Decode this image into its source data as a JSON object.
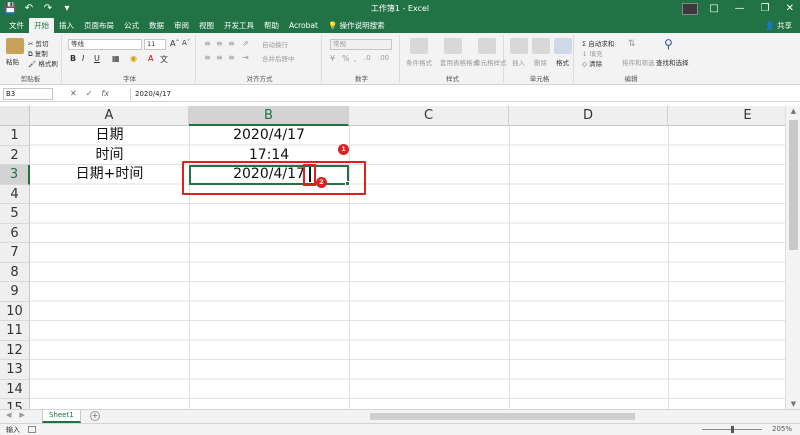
{
  "window": {
    "title": "工作簿1 - Excel"
  },
  "menu_tabs": [
    "文件",
    "开始",
    "插入",
    "页面布局",
    "公式",
    "数据",
    "审阅",
    "视图",
    "开发工具",
    "帮助",
    "Acrobat",
    "操作说明搜索"
  ],
  "share_label": "共享",
  "ribbon": {
    "clipboard": {
      "paste": "粘贴",
      "cut": "剪切",
      "copy": "复制",
      "format_painter": "格式刷",
      "label": "剪贴板"
    },
    "font": {
      "name": "等线",
      "size": "11",
      "label": "字体"
    },
    "alignment": {
      "wrap": "自动换行",
      "merge": "合并后居中",
      "label": "对齐方式"
    },
    "number": {
      "format": "常规",
      "label": "数字"
    },
    "styles": {
      "conditional": "条件格式",
      "table": "套用表格格式",
      "cell_styles": "单元格样式",
      "label": "样式"
    },
    "cells": {
      "insert": "插入",
      "delete": "删除",
      "format": "格式",
      "label": "单元格"
    },
    "editing": {
      "autosum": "自动求和",
      "fill": "填充",
      "clear": "清除",
      "sort": "排序和筛选",
      "find": "查找和选择",
      "label": "编辑"
    }
  },
  "formula_bar": {
    "name_box": "B3",
    "content": "2020/4/17"
  },
  "columns": [
    "A",
    "B",
    "C",
    "D",
    "E"
  ],
  "rows": [
    "1",
    "2",
    "3",
    "4",
    "5",
    "6",
    "7",
    "8",
    "9",
    "10",
    "11",
    "12",
    "13",
    "14",
    "15"
  ],
  "cells": {
    "A1": "日期",
    "B1": "2020/4/17",
    "A2": "时间",
    "B2": "17:14",
    "A3": "日期+时间",
    "B3": "2020/4/17"
  },
  "annotations": {
    "badge1": "1",
    "badge2": "2"
  },
  "sheet_tab": "Sheet1",
  "status": {
    "mode": "输入",
    "zoom": "205%"
  },
  "colors": {
    "accent": "#217346",
    "highlight": "#e02020"
  }
}
